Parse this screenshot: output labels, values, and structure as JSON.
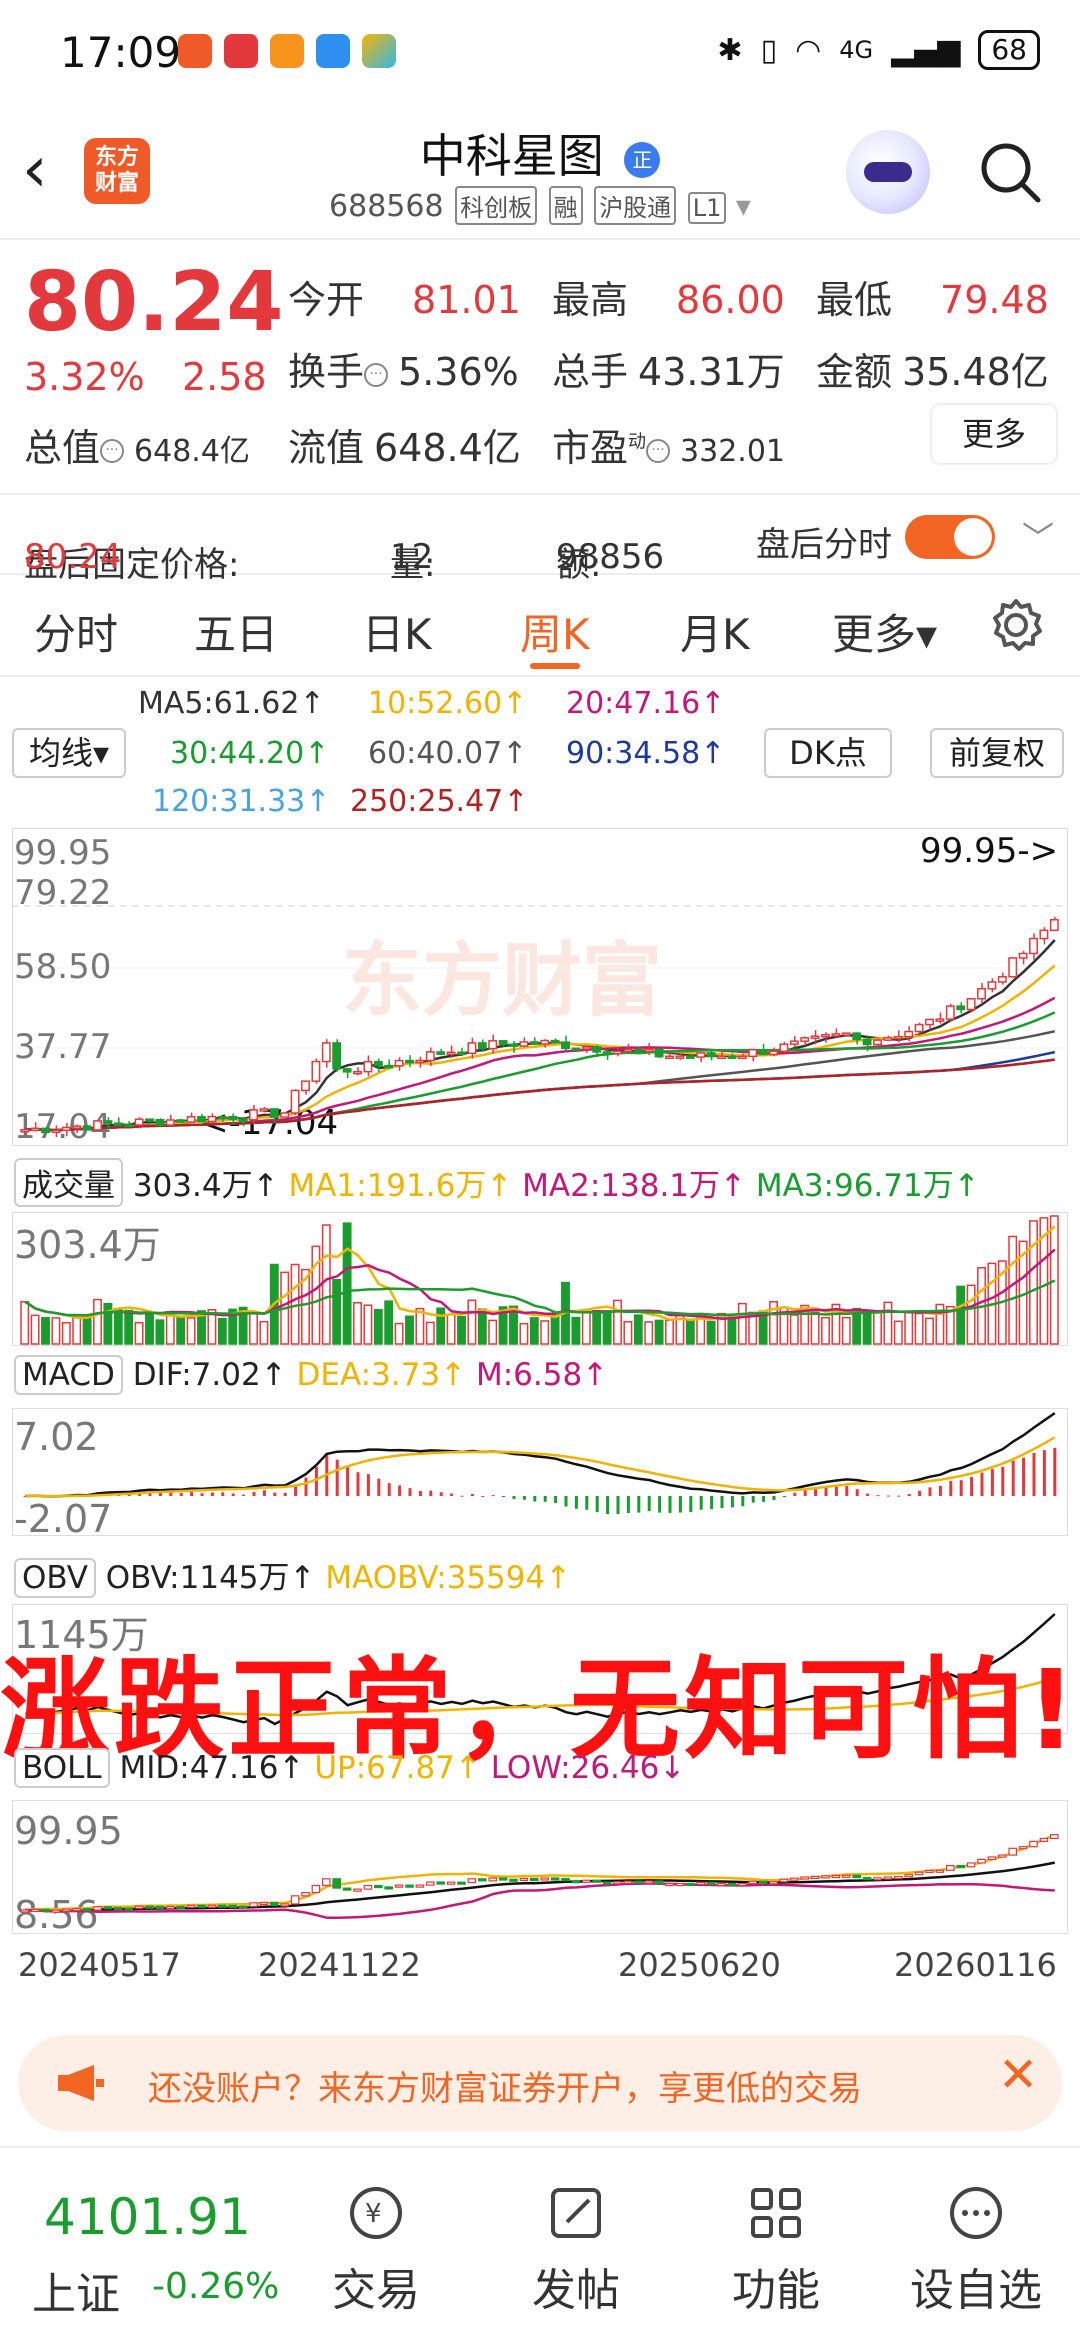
{
  "status_bar": {
    "time": "17:09",
    "network": "4G",
    "battery": "68"
  },
  "header": {
    "logo_text": "东方财富",
    "stock_name": "中科星图",
    "name_badge": "正",
    "code": "688568",
    "tags": [
      "科创板",
      "融",
      "沪股通",
      "L1"
    ]
  },
  "quote": {
    "price": "80.24",
    "change_pct": "3.32%",
    "change": "2.58",
    "open_label": "今开",
    "open": "81.01",
    "high_label": "最高",
    "high": "86.00",
    "low_label": "最低",
    "low": "79.48",
    "turnover_label": "换手",
    "turnover": "5.36%",
    "volume_label": "总手",
    "volume": "43.31万",
    "amount_label": "金额",
    "amount": "35.48亿",
    "mcap_label": "总值",
    "mcap": "648.4亿",
    "float_label": "流值",
    "float": "648.4亿",
    "pe_label": "市盈",
    "pe_sup": "动",
    "pe": "332.01",
    "more_button": "更多"
  },
  "after_hours": {
    "price_label": "盘后固定价格:",
    "price": "80.24",
    "qty_label": "量:",
    "qty": "12",
    "amt_label": "额:",
    "amt": "98856",
    "switch_label": "盘后分时"
  },
  "tabs": [
    "分时",
    "五日",
    "日K",
    "周K",
    "月K",
    "更多▾"
  ],
  "active_tab": "周K",
  "ma_legend": {
    "selector": "均线▾",
    "dk_button": "DK点",
    "fq_button": "前复权",
    "items": [
      {
        "label": "MA5:61.62↑",
        "color": "#333333"
      },
      {
        "label": "10:52.60↑",
        "color": "#f0b400"
      },
      {
        "label": "20:47.16↑",
        "color": "#c2187a"
      },
      {
        "label": "30:44.20↑",
        "color": "#1a9d2e"
      },
      {
        "label": "60:40.07↑",
        "color": "#555555"
      },
      {
        "label": "90:34.58↑",
        "color": "#1e3a9e"
      },
      {
        "label": "120:31.33↑",
        "color": "#4aa3df"
      },
      {
        "label": "250:25.47↑",
        "color": "#b22222"
      }
    ]
  },
  "kline_chart": {
    "y_labels": [
      "99.95",
      "79.22",
      "58.50",
      "37.77",
      "17.04"
    ],
    "max_marker": "99.95->",
    "min_marker": "<-17.04",
    "watermark": "东方财富"
  },
  "volume_panel": {
    "selector": "成交量",
    "value": "303.4万↑",
    "ma1": "MA1:191.6万↑",
    "ma2": "MA2:138.1万↑",
    "ma3": "MA3:96.71万↑",
    "y_label": "303.4万"
  },
  "macd_panel": {
    "selector": "MACD",
    "dif": "DIF:7.02↑",
    "dea": "DEA:3.73↑",
    "m": "M:6.58↑",
    "y_top": "7.02",
    "y_bottom": "-2.07"
  },
  "obv_panel": {
    "selector": "OBV",
    "obv": "OBV:1145万↑",
    "maobv": "MAOBV:35594↑",
    "y_top": "1145万"
  },
  "banner_text": "涨跌正常，无知可怕!",
  "boll_panel": {
    "selector": "BOLL",
    "mid": "MID:47.16↑",
    "up": "UP:67.87↑",
    "low": "LOW:26.46↓",
    "y_top": "99.95",
    "y_bottom": "8.56"
  },
  "x_dates": [
    "20240517",
    "20241122",
    "20250620",
    "20260116"
  ],
  "ad_text": "还没账户？来东方财富证券开户，享更低的交易",
  "bottom_nav": {
    "index_value": "4101.91",
    "index_name": "上证",
    "index_change": "-0.26%",
    "items": [
      "交易",
      "发帖",
      "功能",
      "设自选"
    ]
  },
  "colors": {
    "up": "#e4393c",
    "down": "#1a9d2e",
    "accent": "#f26522"
  }
}
